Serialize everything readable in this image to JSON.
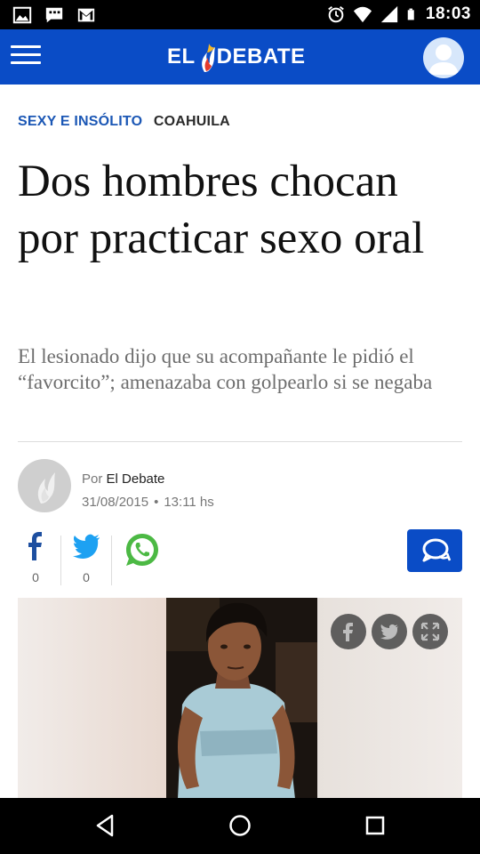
{
  "status_bar": {
    "time": "18:03",
    "left_icons": [
      "image-icon",
      "chat-icon",
      "gmail-icon"
    ],
    "right_icons": [
      "alarm-icon",
      "wifi-icon",
      "signal-icon",
      "battery-icon"
    ]
  },
  "header": {
    "logo_left": "EL",
    "logo_right": "DEBATE",
    "brand_color": "#0a4cc6",
    "menu_icon": "hamburger-icon",
    "account_icon": "user-avatar-icon"
  },
  "article": {
    "category": "SEXY E INSÓLITO",
    "location": "COAHUILA",
    "headline": "Dos hombres chocan por practicar sexo oral",
    "subtitle": "El lesionado dijo que su acompañante le pidió el “favorcito”; amenazaba con golpearlo si se negaba",
    "byline_prefix": "Por",
    "author": "El Debate",
    "date": "31/08/2015",
    "date_separator": "•",
    "time": "13:11 hs"
  },
  "share": {
    "facebook_count": "0",
    "twitter_count": "0",
    "icons": [
      "facebook-icon",
      "twitter-icon",
      "whatsapp-icon",
      "comments-icon"
    ]
  },
  "image_overlay": {
    "icons": [
      "facebook-icon",
      "twitter-icon",
      "fullscreen-icon"
    ]
  },
  "nav_bar": {
    "icons": [
      "back-icon",
      "home-icon",
      "recents-icon"
    ]
  }
}
